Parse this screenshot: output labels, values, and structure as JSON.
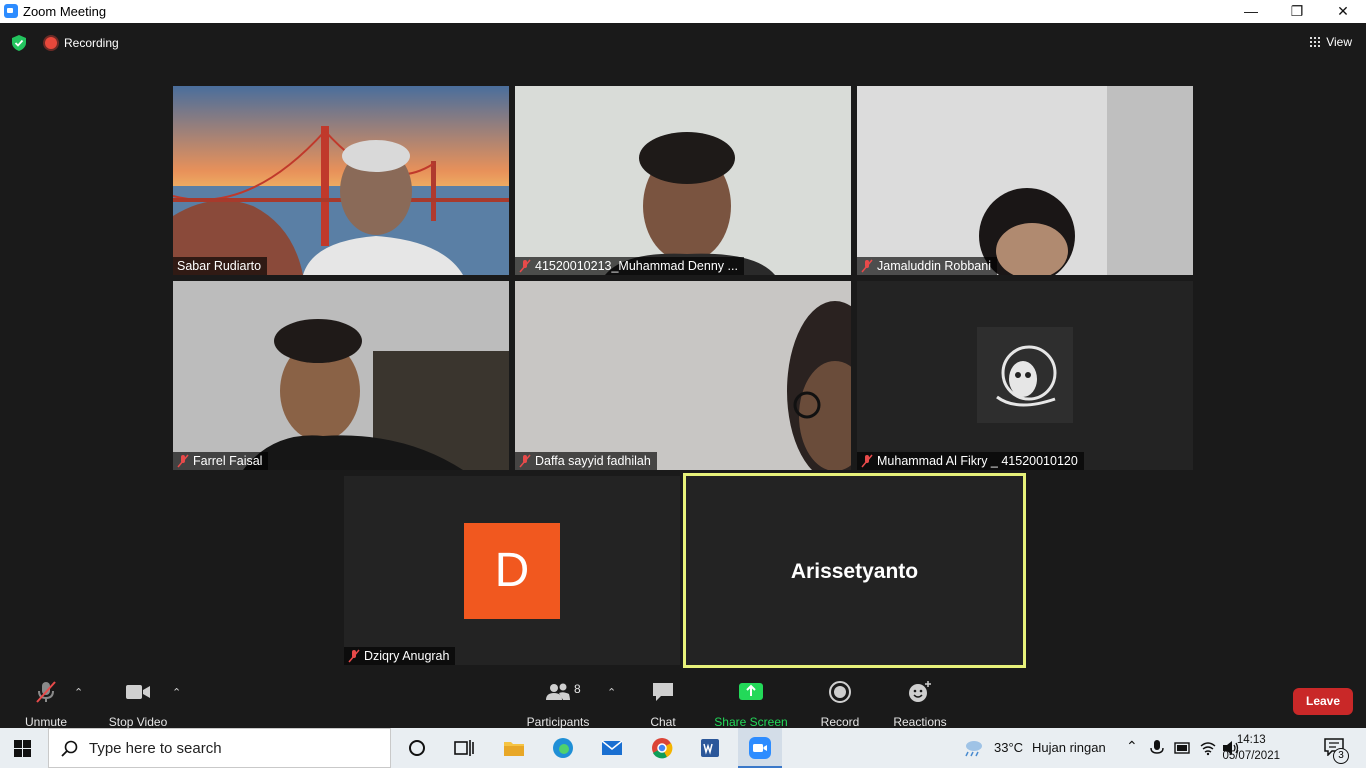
{
  "window": {
    "title": "Zoom Meeting",
    "min": "—",
    "restore": "❐",
    "close": "✕"
  },
  "meeting": {
    "recording_label": "Recording",
    "view_label": "View"
  },
  "participants": [
    {
      "name": "Sabar Rudiarto",
      "muted": false
    },
    {
      "name": "41520010213_Muhammad Denny ...",
      "muted": true
    },
    {
      "name": "Jamaluddin Robbani",
      "muted": true
    },
    {
      "name": "Farrel Faisal",
      "muted": true
    },
    {
      "name": "Daffa sayyid fadhilah",
      "muted": true
    },
    {
      "name": "Muhammad Al Fikry _ 41520010120",
      "muted": true
    },
    {
      "name": "Dziqry Anugrah",
      "muted": true,
      "avatar_letter": "D",
      "avatar_color": "#f1581f"
    },
    {
      "name": "Arissetyanto",
      "active_speaker": true
    }
  ],
  "toolbar": {
    "unmute": "Unmute",
    "stop_video": "Stop Video",
    "participants": "Participants",
    "participants_count": "8",
    "chat": "Chat",
    "share_screen": "Share Screen",
    "record": "Record",
    "reactions": "Reactions",
    "leave": "Leave",
    "share_color": "#23d959",
    "leave_color": "#c92828"
  },
  "taskbar": {
    "search_placeholder": "Type here to search",
    "weather_temp": "33°C",
    "weather_desc": "Hujan ringan",
    "time": "14:13",
    "date": "05/07/2021",
    "notifications": "3"
  }
}
